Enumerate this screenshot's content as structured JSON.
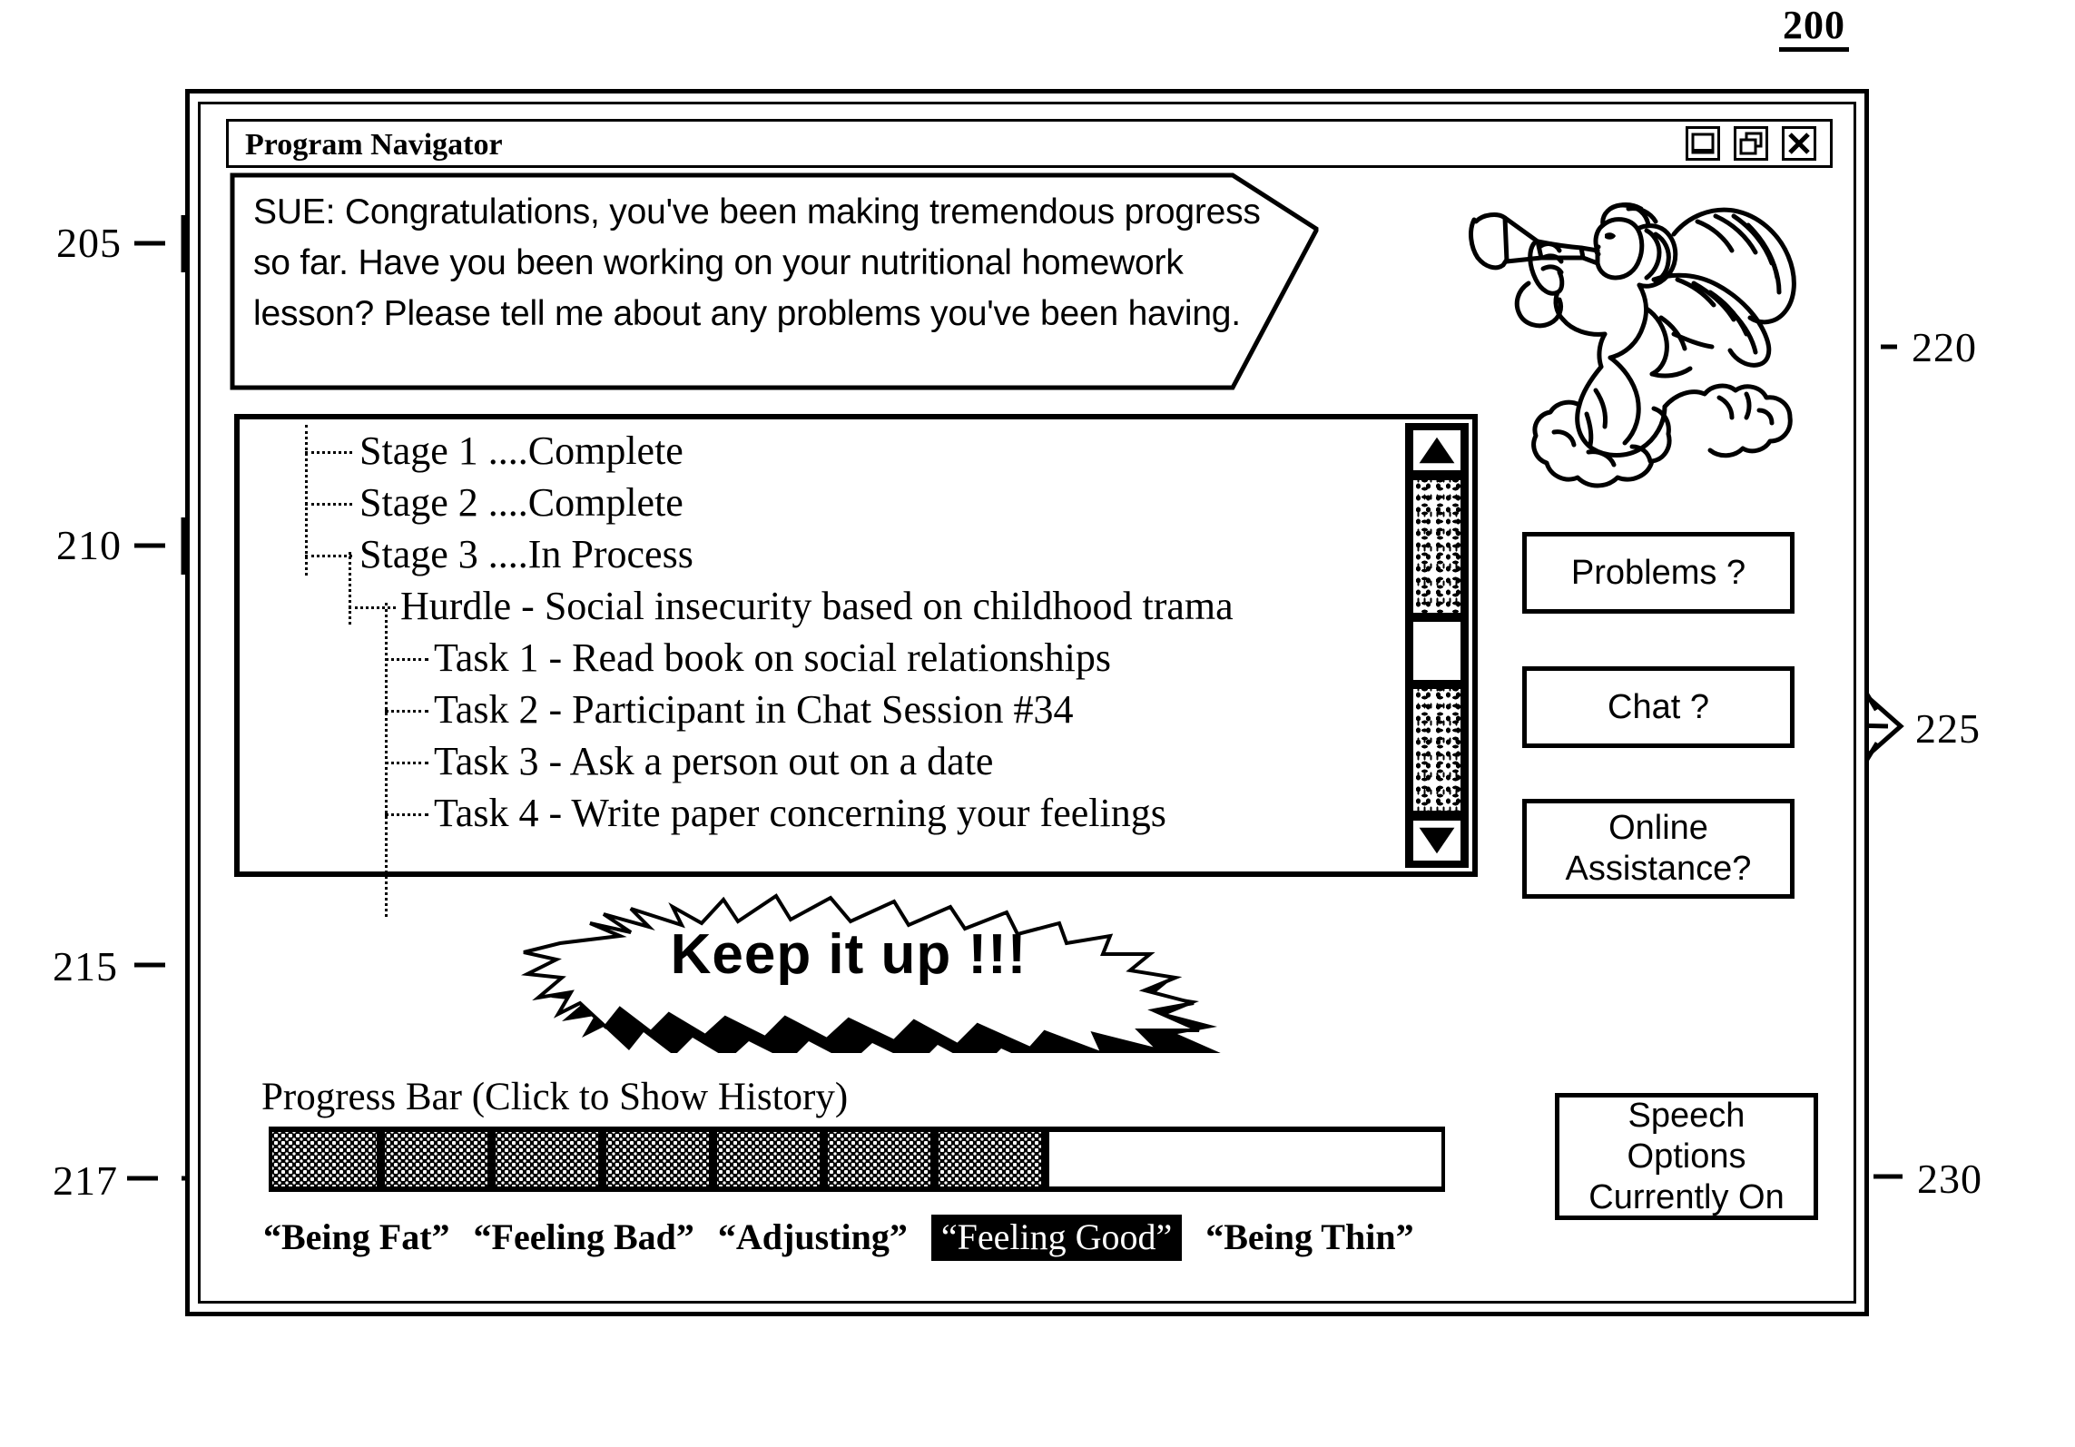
{
  "figure": {
    "number": "200"
  },
  "window": {
    "title": "Program Navigator",
    "controls": [
      {
        "name": "minimize",
        "icon": "minimize-icon"
      },
      {
        "name": "restore",
        "icon": "restore-icon"
      },
      {
        "name": "close",
        "icon": "close-icon"
      }
    ]
  },
  "speech_bubble": {
    "text": "SUE: Congratulations, you've been making tremendous progress so far.  Have you been working on your nutritional homework lesson? Please tell me about any problems you've been having."
  },
  "avatar": {
    "icon": "cherub-angel-with-trumpet-icon",
    "description": "Angel blowing trumpet on cloud"
  },
  "tree": {
    "items": [
      {
        "level": 1,
        "label": "Stage 1 ....Complete"
      },
      {
        "level": 1,
        "label": "Stage 2 ....Complete"
      },
      {
        "level": 1,
        "label": "Stage 3 ....In Process"
      },
      {
        "level": 2,
        "label": "Hurdle - Social insecurity based on childhood trama"
      },
      {
        "level": 3,
        "label": "Task 1 - Read book on social relationships"
      },
      {
        "level": 3,
        "label": "Task 2 - Participant in Chat Session #34"
      },
      {
        "level": 3,
        "label": "Task 3 - Ask a person out on a date"
      },
      {
        "level": 3,
        "label": "Task 4 - Write paper concerning your feelings"
      }
    ],
    "scrollbar": {
      "up_icon": "triangle-up-icon",
      "down_icon": "triangle-down-icon"
    }
  },
  "side_buttons": {
    "problems": "Problems ?",
    "chat": "Chat ?",
    "online_assistance": "Online\nAssistance?"
  },
  "encouragement": {
    "text": "Keep it up !!!"
  },
  "progress": {
    "caption": "Progress Bar (Click to Show History)",
    "segments_filled": 7,
    "segments_total": 10,
    "labels": [
      {
        "text": "“Being Fat”",
        "current": false
      },
      {
        "text": "“Feeling Bad”",
        "current": false
      },
      {
        "text": "“Adjusting”",
        "current": false
      },
      {
        "text": "“Feeling Good”",
        "current": true
      },
      {
        "text": "“Being Thin”",
        "current": false
      }
    ]
  },
  "speech_options": {
    "text": "Speech\nOptions\nCurrently On"
  },
  "reference_numerals": {
    "r205": "205",
    "r210": "210",
    "r215": "215",
    "r217": "217",
    "r220": "220",
    "r225": "225",
    "r230": "230"
  }
}
